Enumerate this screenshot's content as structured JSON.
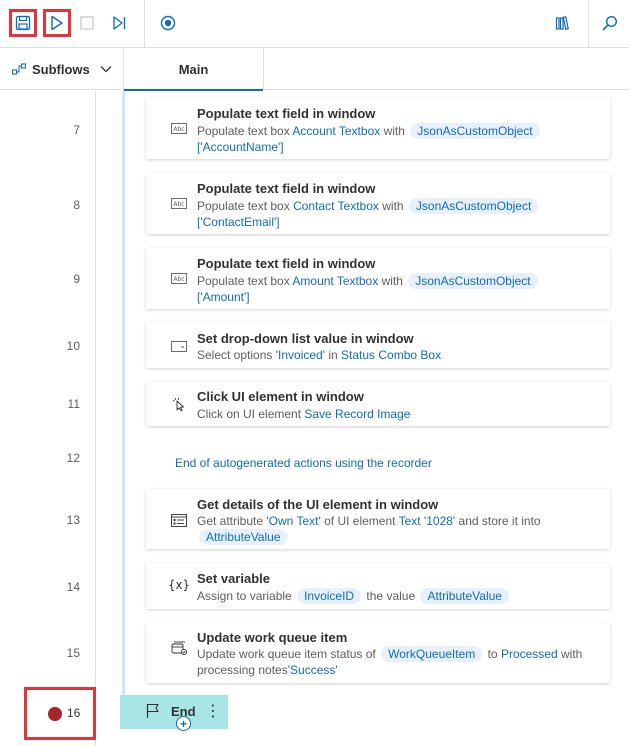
{
  "toolbar": {
    "buttons": [
      {
        "name": "save",
        "icon": "save-icon"
      },
      {
        "name": "run",
        "icon": "play-icon"
      },
      {
        "name": "stop",
        "icon": "stop-icon"
      },
      {
        "name": "run-next",
        "icon": "step-next-icon"
      },
      {
        "name": "record",
        "icon": "record-icon"
      },
      {
        "name": "assets",
        "icon": "library-icon"
      },
      {
        "name": "search",
        "icon": "search-icon"
      }
    ]
  },
  "tabs": {
    "subflows_label": "Subflows",
    "main_label": "Main"
  },
  "actions": [
    {
      "line": "7",
      "icon": "text-field-icon",
      "title": "Populate text field in window",
      "desc": {
        "prefix": "Populate text box ",
        "element": "Account Textbox",
        "mid": " with ",
        "var": "JsonAsCustomObject",
        "suffix": "['AccountName']"
      }
    },
    {
      "line": "8",
      "icon": "text-field-icon",
      "title": "Populate text field in window",
      "desc": {
        "prefix": "Populate text box ",
        "element": "Contact Textbox",
        "mid": " with ",
        "var": "JsonAsCustomObject",
        "suffix": "['ContactEmail']"
      }
    },
    {
      "line": "9",
      "icon": "text-field-icon",
      "title": "Populate text field in window",
      "desc": {
        "prefix": "Populate text box ",
        "element": "Amount Textbox",
        "mid": " with ",
        "var": "JsonAsCustomObject",
        "suffix": "['Amount']"
      }
    },
    {
      "line": "10",
      "icon": "dropdown-icon",
      "title": "Set drop-down list value in window",
      "desc": {
        "prefix": "Select options ",
        "value": "'Invoiced'",
        "mid": " in ",
        "element": "Status Combo Box"
      }
    },
    {
      "line": "11",
      "icon": "click-icon",
      "title": "Click UI element in window",
      "desc": {
        "prefix": "Click on UI element ",
        "element": "Save Record Image"
      }
    },
    {
      "line": "13",
      "icon": "ui-details-icon",
      "title": "Get details of the UI element in window",
      "desc": {
        "prefix": "Get attribute ",
        "attr": "'Own Text'",
        "mid": " of UI element ",
        "element": "Text '1028'",
        "mid2": " and store it into",
        "var": "AttributeValue"
      }
    },
    {
      "line": "14",
      "icon": "variable-icon",
      "title": "Set variable",
      "desc": {
        "prefix": "Assign to variable ",
        "var": "InvoiceID",
        "mid": " the value ",
        "var2": "AttributeValue"
      }
    },
    {
      "line": "15",
      "icon": "work-queue-icon",
      "title": "Update work queue item",
      "desc": {
        "prefix": "Update work queue item status of ",
        "var": "WorkQueueItem",
        "mid": " to ",
        "status": "Processed",
        "mid2": " with processing notes",
        "notes": "'Success'"
      }
    }
  ],
  "comment": {
    "line": "12",
    "text": "End of autogenerated actions using the recorder"
  },
  "end": {
    "line": "16",
    "label": "End",
    "more": "⋮",
    "add": "+",
    "breakpoint_color": "#a4262c"
  },
  "colors": {
    "accent": "#0f6cbd",
    "highlight": "#e0353b",
    "end_bar": "#a8e6e6"
  }
}
